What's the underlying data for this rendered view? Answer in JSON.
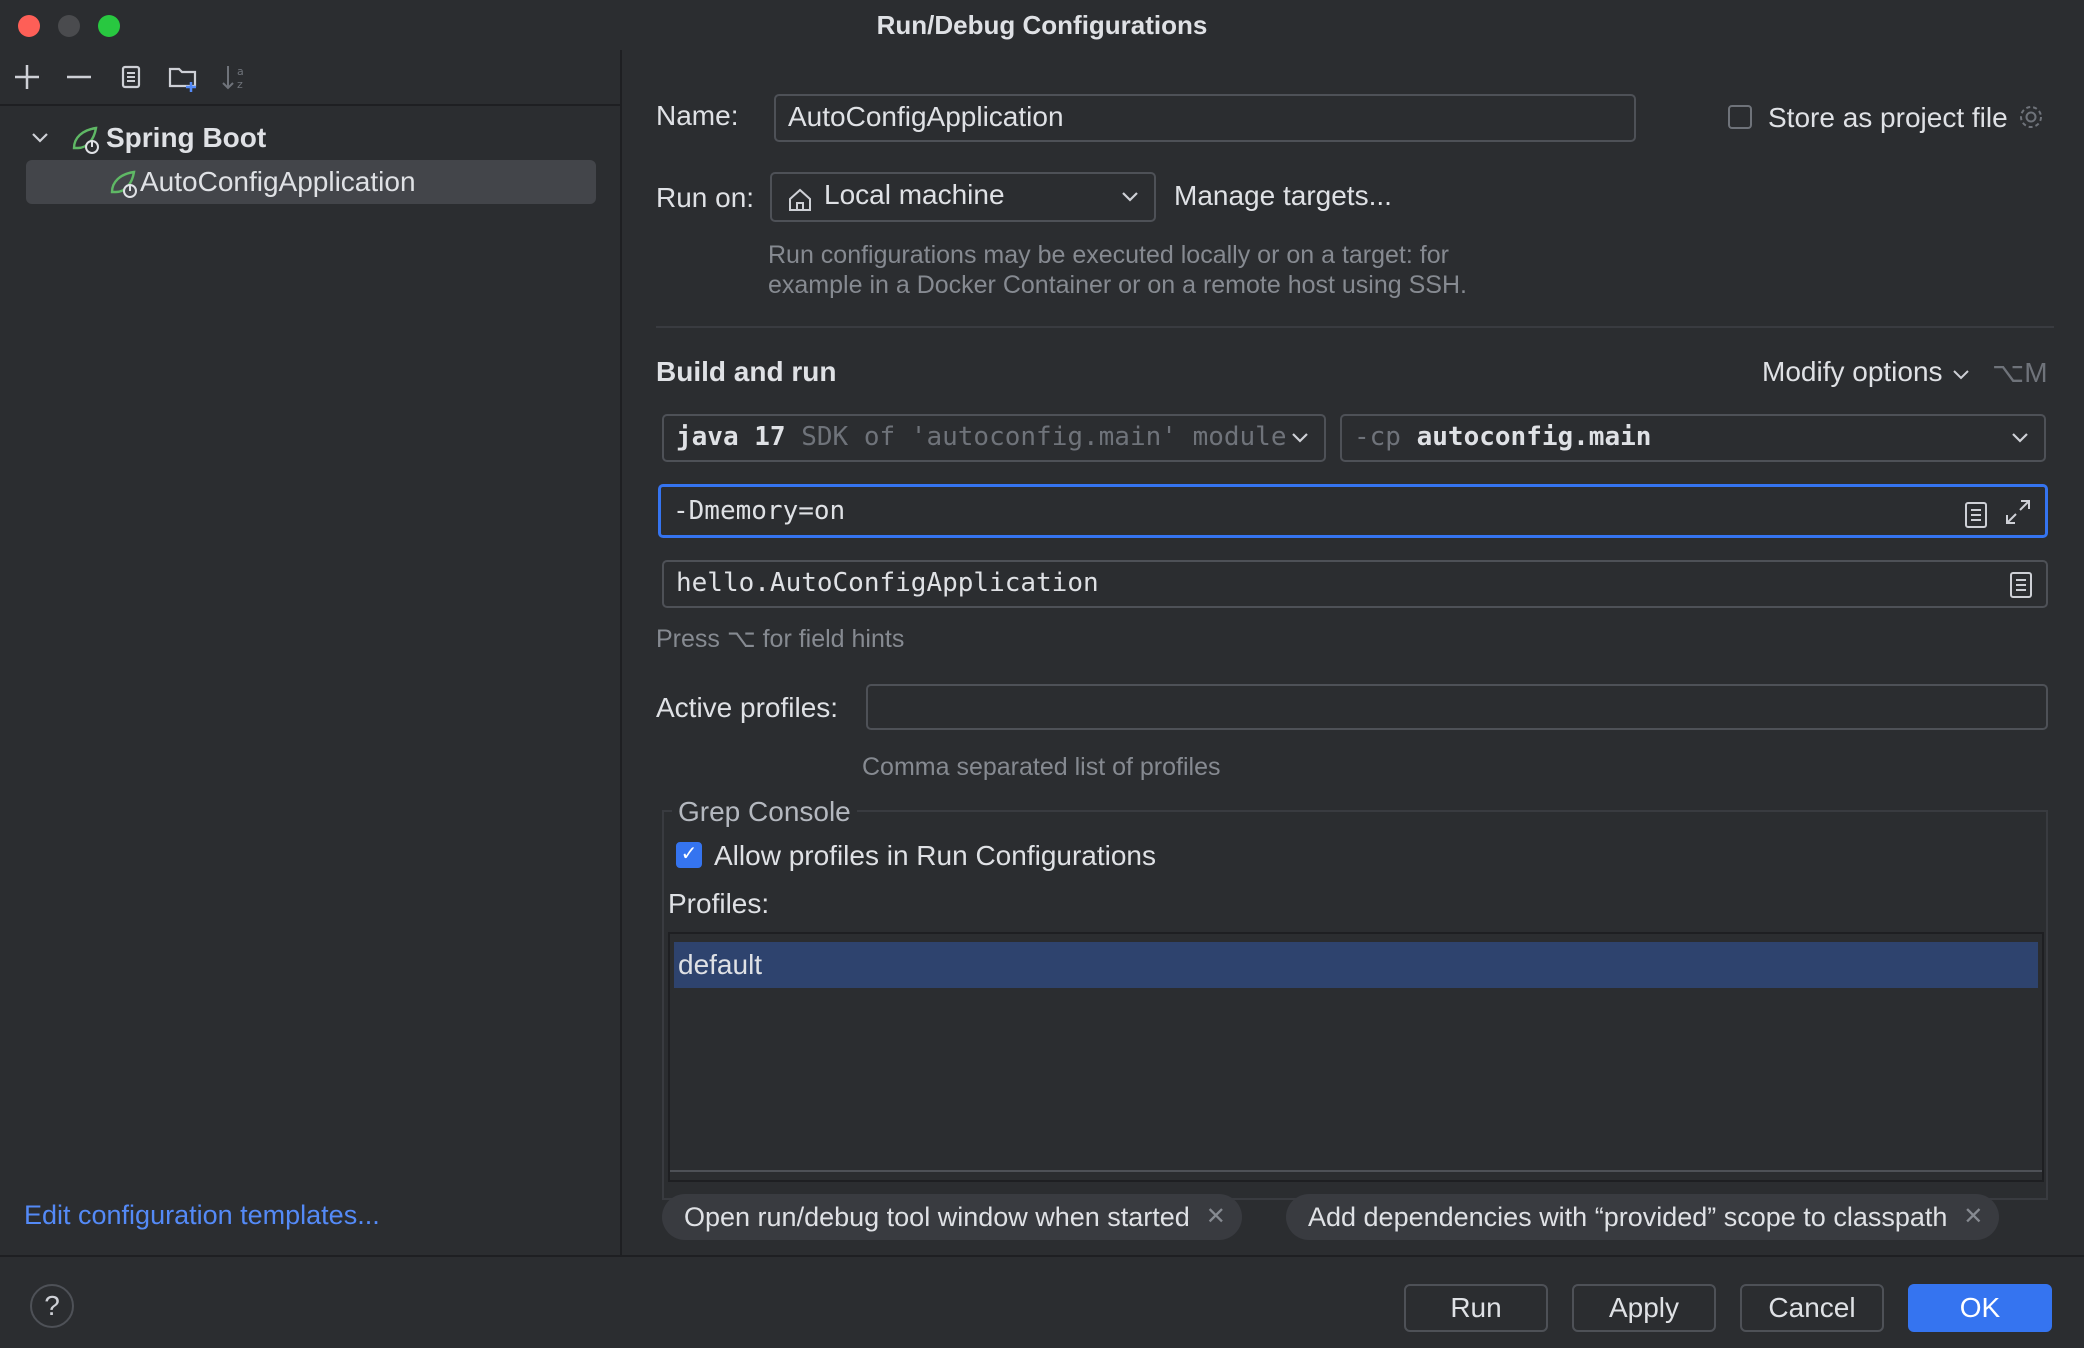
{
  "window": {
    "title": "Run/Debug Configurations"
  },
  "toolbar": {
    "icons": [
      "add-icon",
      "remove-icon",
      "copy-icon",
      "new-folder-icon",
      "sort-icon"
    ]
  },
  "tree": {
    "group_label": "Spring Boot",
    "items": [
      {
        "label": "AutoConfigApplication"
      }
    ]
  },
  "left_footer": {
    "edit_templates_link": "Edit configuration templates..."
  },
  "form": {
    "name_label": "Name:",
    "name_value": "AutoConfigApplication",
    "store_label": "Store as project file",
    "run_on_label": "Run on:",
    "run_on_value": "Local machine",
    "manage_targets": "Manage targets...",
    "run_on_hint_line1": "Run configurations may be executed locally or on a target: for",
    "run_on_hint_line2": "example in a Docker Container or on a remote host using SSH.",
    "section_title": "Build and run",
    "modify_options": "Modify options",
    "modify_shortcut": "⌥M",
    "sdk_value": "java 17",
    "sdk_hint": "SDK of 'autoconfig.main' module",
    "cp_prefix": "-cp",
    "cp_value": "autoconfig.main",
    "vm_options": "-Dmemory=on",
    "main_class": "hello.AutoConfigApplication",
    "field_hints": "Press ⌥ for field hints",
    "active_profiles_label": "Active profiles:",
    "active_profiles_value": "",
    "active_profiles_hint": "Comma separated list of profiles"
  },
  "grep_console": {
    "title": "Grep Console",
    "allow_label": "Allow profiles in Run Configurations",
    "allow_checked": true,
    "profiles_label": "Profiles:",
    "profiles": [
      "default"
    ]
  },
  "chips": [
    {
      "label": "Open run/debug tool window when started"
    },
    {
      "label": "Add dependencies with “provided” scope to classpath"
    }
  ],
  "buttons": {
    "run": "Run",
    "apply": "Apply",
    "cancel": "Cancel",
    "ok": "OK",
    "help": "?"
  },
  "colors": {
    "accent": "#3574f0",
    "link": "#548af7",
    "background": "#2b2d30",
    "selection": "#2e436e"
  }
}
